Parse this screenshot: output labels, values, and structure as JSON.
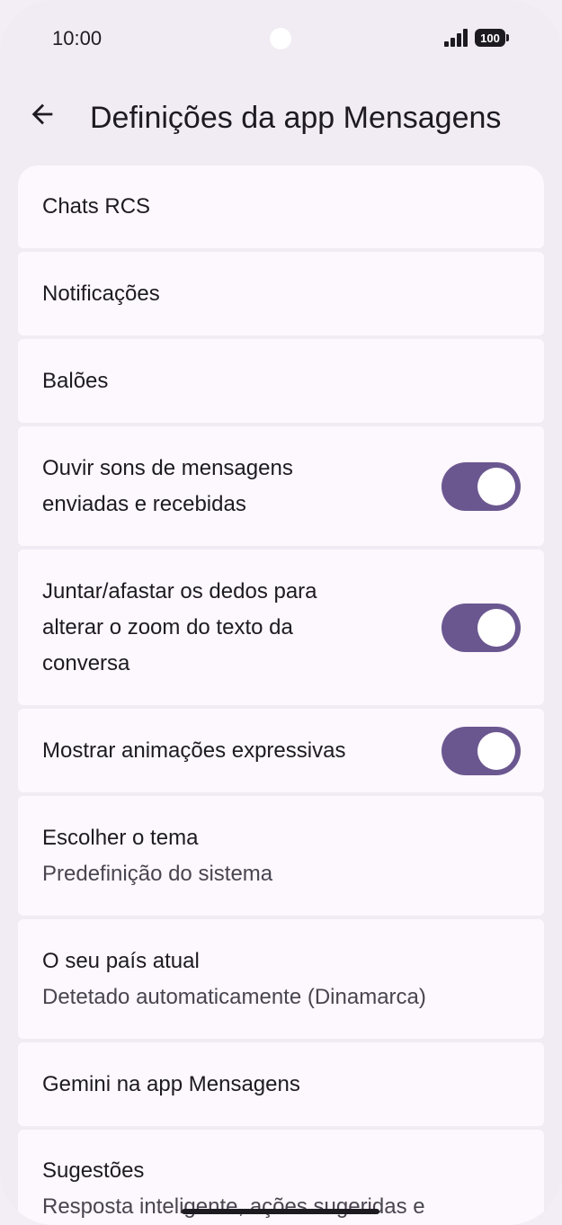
{
  "status_bar": {
    "time": "10:00",
    "battery": "100",
    "icons": [
      "signal-icon",
      "battery-icon"
    ]
  },
  "app_bar": {
    "back_icon": "arrow-back-icon",
    "title": "Definições da app Mensagens"
  },
  "colors": {
    "background": "#f1ebf3",
    "card": "#fdf7fe",
    "toggle_on": "#6b5790",
    "text_primary": "#1d1b20",
    "text_secondary": "#49454f"
  },
  "settings": [
    {
      "title": "Chats RCS"
    },
    {
      "title": "Notificações"
    },
    {
      "title": "Balões"
    },
    {
      "title": "Ouvir sons de mensagens enviadas e recebidas",
      "toggle": true
    },
    {
      "title": "Juntar/afastar os dedos para alterar o zoom do texto da conversa",
      "toggle": true
    },
    {
      "title": "Mostrar animações expressivas",
      "toggle": true
    },
    {
      "title": "Escolher o tema",
      "subtitle": "Predefinição do sistema"
    },
    {
      "title": "O seu país atual",
      "subtitle": "Detetado automaticamente (Dinamarca)"
    },
    {
      "title": "Gemini na app Mensagens"
    },
    {
      "title": "Sugestões",
      "subtitle": "Resposta inteligente, ações sugeridas e"
    }
  ]
}
